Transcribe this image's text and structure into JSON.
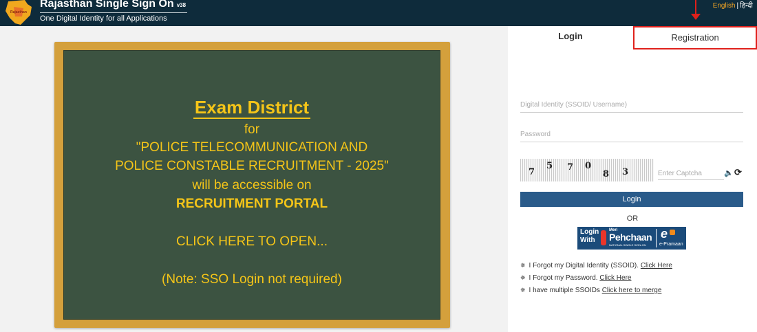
{
  "header": {
    "title": "Rajasthan Single Sign On",
    "version": "v38",
    "tagline": "One Digital Identity for all Applications",
    "lang_english": "English",
    "lang_separator": "|",
    "lang_hindi": "हिन्दी",
    "background_color": "#0e2b3b"
  },
  "board": {
    "title": "Exam District",
    "line1": "for",
    "line2": "\"POLICE TELECOMMUNICATION AND",
    "line3": "POLICE CONSTABLE RECRUITMENT - 2025\"",
    "line4": "will be accessible on",
    "line5": "RECRUITMENT PORTAL",
    "line6": "CLICK HERE TO OPEN...",
    "line7": "(Note: SSO Login not required)",
    "board_color": "#3c5341",
    "frame_color": "#d4a03c",
    "text_color": "#f5c518"
  },
  "carousel": {
    "slide_count": 6,
    "active_index": 2
  },
  "tabs": {
    "login": "Login",
    "registration": "Registration"
  },
  "form": {
    "username_placeholder": "Digital Identity (SSOID/ Username)",
    "password_placeholder": "Password",
    "captcha_digits": [
      "7",
      "5",
      "7",
      "0",
      "8",
      "3"
    ],
    "captcha_placeholder": "Enter Captcha",
    "login_button": "Login",
    "or_text": "OR",
    "button_color": "#2a5b8a"
  },
  "pehchaan": {
    "login_with_line1": "Login",
    "login_with_line2": "With",
    "meri": "Meri",
    "name": "Pehchaan",
    "subtitle": "NATIONAL SINGLE SIGN-ON",
    "epramaan": "e-Pramaan"
  },
  "links": [
    {
      "text": "I Forgot my Digital Identity (SSOID).",
      "link": "Click Here"
    },
    {
      "text": "I Forgot my Password.",
      "link": "Click Here"
    },
    {
      "text": "I have multiple SSOIDs",
      "link": "Click here to merge"
    }
  ],
  "icons": {
    "logo": "rajasthan-logo",
    "speaker": "speaker-icon",
    "refresh": "refresh-icon",
    "bullet": "star-icon",
    "annotation": "red-arrow"
  }
}
